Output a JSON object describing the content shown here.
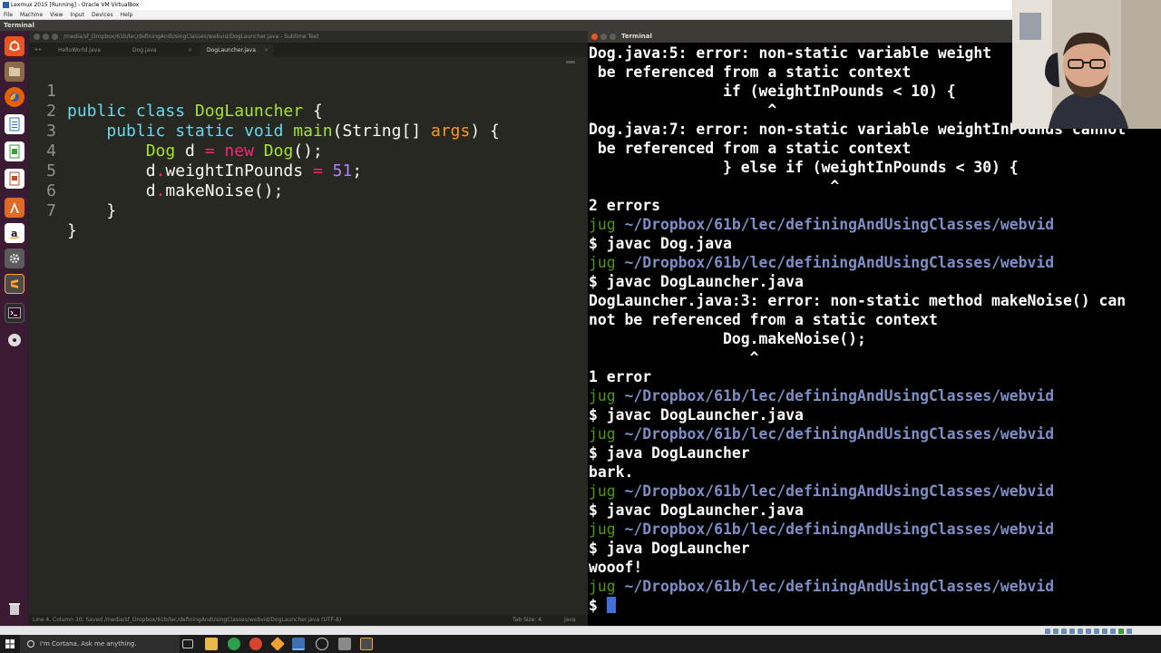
{
  "host": {
    "title": "Lexmux 2015 [Running] - Oracle VM VirtualBox",
    "menu": [
      "File",
      "Machine",
      "View",
      "Input",
      "Devices",
      "Help"
    ]
  },
  "ubuntu_panel": {
    "app_name": "Terminal"
  },
  "launcher": {
    "items": [
      {
        "icon": "ubuntu-dash-icon",
        "color": "#e95420"
      },
      {
        "icon": "files-icon",
        "color": "#8b6a4a"
      },
      {
        "icon": "firefox-icon",
        "color": "#e66000"
      },
      {
        "icon": "libreoffice-writer-icon",
        "color": "#2a74c5"
      },
      {
        "icon": "libreoffice-calc-icon",
        "color": "#3a9c3a"
      },
      {
        "icon": "libreoffice-impress-icon",
        "color": "#c64b1c"
      },
      {
        "icon": "software-center-icon",
        "color": "#e06a24"
      },
      {
        "icon": "amazon-icon",
        "color": "#222222"
      },
      {
        "icon": "system-settings-icon",
        "color": "#7a7a7a"
      },
      {
        "icon": "sublime-text-icon",
        "color": "#4b4b4b"
      },
      {
        "icon": "terminal-icon",
        "color": "#2b2b2b"
      },
      {
        "icon": "dvd-icon",
        "color": "#9a9a9a"
      }
    ],
    "trash_icon": "trash-icon"
  },
  "sublime": {
    "title": "/media/sf_Dropbox/61b/lec/definingAndUsingClasses/webvid/DogLauncher.java - Sublime Text",
    "tabs": [
      {
        "label": "HelloWorld.java",
        "active": false
      },
      {
        "label": "Dog.java",
        "active": false
      },
      {
        "label": "DogLauncher.java",
        "active": true
      }
    ],
    "line_numbers": [
      "1",
      "2",
      "3",
      "4",
      "5",
      "6",
      "7"
    ],
    "status_left": "Line 4, Column 30; Saved /media/sf_Dropbox/61b/lec/definingAndUsingClasses/webvid/DogLauncher.java (UTF-8)",
    "status_tab": "Tab Size: 4",
    "status_syntax": "Java"
  },
  "code": {
    "l1_kw": "public class ",
    "l1_cls": "DogLauncher",
    "l1_rest": " {",
    "l2_indent": "    ",
    "l2_kw": "public static void ",
    "l2_fn": "main",
    "l2_p1": "(String[] ",
    "l2_arg": "args",
    "l2_p2": ") {",
    "l3_indent": "        ",
    "l3_type": "Dog",
    "l3_var": " d ",
    "l3_eq": "=",
    "l3_sp": " ",
    "l3_new": "new",
    "l3_sp2": " ",
    "l3_ctor": "Dog",
    "l3_end": "();",
    "l4_indent": "        ",
    "l4_d": "d",
    "l4_dot": ".",
    "l4_field": "weightInPounds ",
    "l4_eq": "=",
    "l4_sp": " ",
    "l4_num": "51",
    "l4_end": ";",
    "l5_indent": "        ",
    "l5_d": "d",
    "l5_dot": ".",
    "l5_call": "makeNoise();",
    "l6": "    }",
    "l7": "}"
  },
  "terminal": {
    "title": "Terminal",
    "prompt_user": "jug",
    "prompt_path": " ~/Dropbox/61b/lec/definingAndUsingClasses/webvid",
    "prompt_sign": "$ ",
    "lines": {
      "l01": "Dog.java:5: error: non-static variable weight",
      "l02": " be referenced from a static context",
      "l03": "               if (weightInPounds < 10) {",
      "l04": "                    ^",
      "l05": "Dog.java:7: error: non-static variable weightInPounds cannot",
      "l06": " be referenced from a static context",
      "l07": "               } else if (weightInPounds < 30) {",
      "l08": "                           ^",
      "l09": "2 errors",
      "c1": "javac Dog.java",
      "c2": "javac DogLauncher.java",
      "e1": "DogLauncher.java:3: error: non-static method makeNoise() can",
      "e2": "not be referenced from a static context",
      "e3": "               Dog.makeNoise();",
      "e4": "                  ^",
      "e5": "1 error",
      "c3": "javac DogLauncher.java",
      "c4": "java DogLauncher",
      "o1": "bark.",
      "c5": "javac DogLauncher.java",
      "c6": "java DogLauncher",
      "o2": "wooof!"
    }
  },
  "taskbar": {
    "cortana_placeholder": "I'm Cortana. Ask me anything.",
    "items": [
      "task-view-icon",
      "file-explorer-icon",
      "chrome-icon",
      "chrome-icon",
      "git-icon",
      "virtualbox-icon",
      "unity-icon",
      "game-icon",
      "sublime-text-icon"
    ]
  },
  "colors": {
    "accent_ubuntu": "#e95420",
    "prompt_green": "#4e9a06",
    "prompt_path": "#7d8ec6",
    "monokai_bg": "#272822"
  }
}
